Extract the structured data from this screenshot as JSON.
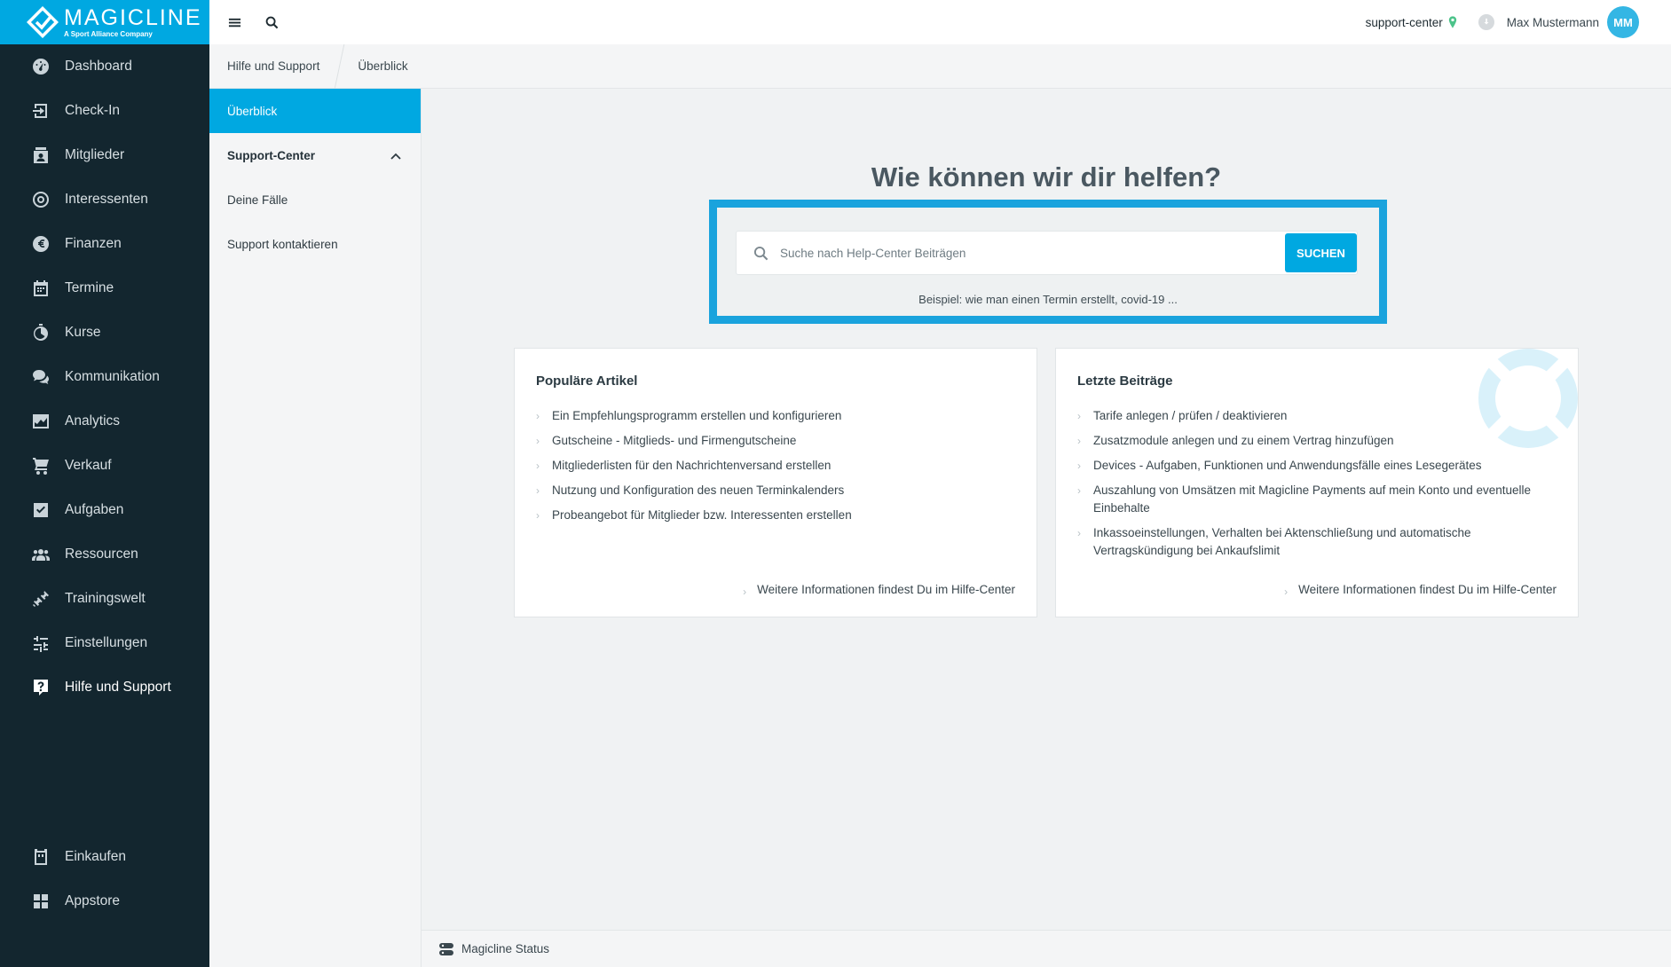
{
  "brand": {
    "name": "MAGICLINE",
    "tagline": "A Sport Alliance Company",
    "color": "#00a8e1"
  },
  "sidebar": {
    "items": [
      {
        "label": "Dashboard",
        "icon": "dashboard-icon"
      },
      {
        "label": "Check-In",
        "icon": "check-in-icon"
      },
      {
        "label": "Mitglieder",
        "icon": "members-icon"
      },
      {
        "label": "Interessenten",
        "icon": "prospects-icon"
      },
      {
        "label": "Finanzen",
        "icon": "euro-icon"
      },
      {
        "label": "Termine",
        "icon": "calendar-icon"
      },
      {
        "label": "Kurse",
        "icon": "stopwatch-icon"
      },
      {
        "label": "Kommunikation",
        "icon": "chat-icon"
      },
      {
        "label": "Analytics",
        "icon": "chart-icon"
      },
      {
        "label": "Verkauf",
        "icon": "cart-icon"
      },
      {
        "label": "Aufgaben",
        "icon": "checkbox-icon"
      },
      {
        "label": "Ressourcen",
        "icon": "people-icon"
      },
      {
        "label": "Trainingswelt",
        "icon": "dumbbell-icon"
      },
      {
        "label": "Einstellungen",
        "icon": "sliders-icon"
      },
      {
        "label": "Hilfe und Support",
        "icon": "help-icon",
        "active": true
      }
    ],
    "bottom": [
      {
        "label": "Einkaufen",
        "icon": "store-icon"
      },
      {
        "label": "Appstore",
        "icon": "apps-icon"
      }
    ]
  },
  "topbar": {
    "studio": "support-center",
    "user_name": "Max Mustermann",
    "user_initials": "MM"
  },
  "breadcrumb": [
    "Hilfe und Support",
    "Überblick"
  ],
  "subnav": {
    "overview": "Überblick",
    "support_center": "Support-Center",
    "my_cases": "Deine Fälle",
    "contact": "Support kontaktieren"
  },
  "main": {
    "headline": "Wie können wir dir helfen?",
    "search": {
      "placeholder": "Suche nach Help-Center Beiträgen",
      "value": "",
      "button": "SUCHEN",
      "example": "Beispiel: wie man einen Termin erstellt, covid-19 ..."
    },
    "popular": {
      "title": "Populäre Artikel",
      "items": [
        "Ein Empfehlungsprogramm erstellen und konfigurieren",
        "Gutscheine - Mitglieds- und Firmengutscheine",
        "Mitgliederlisten für den Nachrichtenversand erstellen",
        "Nutzung und Konfiguration des neuen Terminkalenders",
        "Probeangebot für Mitglieder bzw. Interessenten erstellen"
      ],
      "more": "Weitere Informationen findest Du im Hilfe-Center"
    },
    "recent": {
      "title": "Letzte Beiträge",
      "items": [
        "Tarife anlegen / prüfen / deaktivieren",
        "Zusatzmodule anlegen und zu einem Vertrag hinzufügen",
        "Devices - Aufgaben, Funktionen und Anwendungsfälle eines Lesegerätes",
        "Auszahlung von Umsätzen mit Magicline Payments auf mein Konto und eventuelle Einbehalte",
        "Inkassoeinstellungen, Verhalten bei Aktenschließung und automatische Vertragskündigung bei Ankaufslimit"
      ],
      "more": "Weitere Informationen findest Du im Hilfe-Center"
    }
  },
  "footer": {
    "status": "Magicline Status"
  }
}
